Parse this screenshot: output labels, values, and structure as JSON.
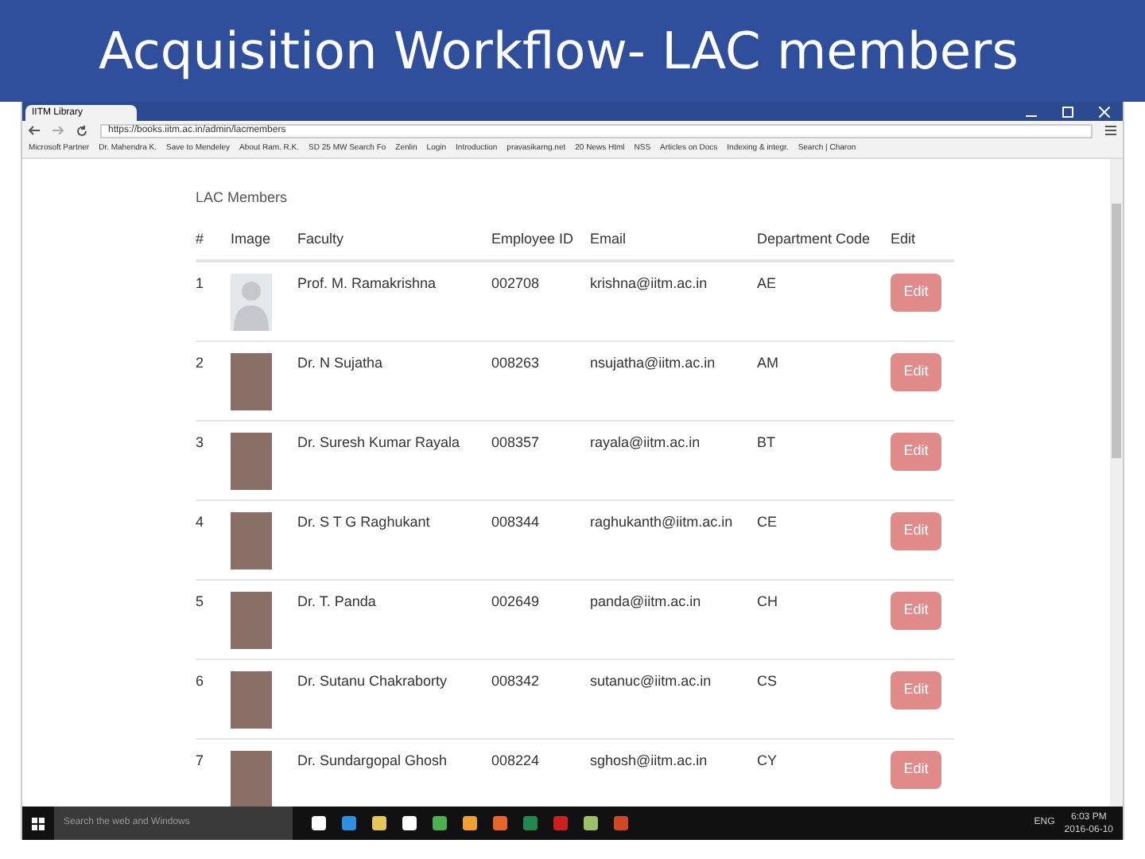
{
  "slide": {
    "title": "Acquisition Workflow- LAC members"
  },
  "browser": {
    "tab": {
      "title": "IITM Library",
      "selected": true
    },
    "url": "https://books.iitm.ac.in/admin/lacmembers",
    "bookmarks": [
      "Microsoft Partner",
      "Dr. Mahendra K.",
      "Save to Mendeley",
      "About Ram. R.K.",
      "SD 25 MW Search Fo",
      "Zenlin",
      "Login",
      "Introduction",
      "pravasikarng.net",
      "20 News Html",
      "NSS",
      "Articles on Docs",
      "Indexing & integr.",
      "Search | Charon"
    ]
  },
  "page": {
    "heading": "LAC Members",
    "table": {
      "columns": [
        "#",
        "Image",
        "Faculty",
        "Employee ID",
        "Email",
        "Department Code",
        "Edit"
      ],
      "rows": [
        {
          "number": "1",
          "kind": "placeholder",
          "faculty": "Prof. M. Ramakrishna",
          "employee_id": "002708",
          "email": "krishna@iitm.ac.in",
          "department": "AE",
          "action": "Edit"
        },
        {
          "number": "2",
          "kind": "photo",
          "faculty": "Dr. N Sujatha",
          "employee_id": "008263",
          "email": "nsujatha@iitm.ac.in",
          "department": "AM",
          "action": "Edit"
        },
        {
          "number": "3",
          "kind": "photo",
          "faculty": "Dr. Suresh Kumar Rayala",
          "employee_id": "008357",
          "email": "rayala@iitm.ac.in",
          "department": "BT",
          "action": "Edit"
        },
        {
          "number": "4",
          "kind": "photo",
          "faculty": "Dr. S T G Raghukant",
          "employee_id": "008344",
          "email": "raghukanth@iitm.ac.in",
          "department": "CE",
          "action": "Edit"
        },
        {
          "number": "5",
          "kind": "photo",
          "faculty": "Dr. T. Panda",
          "employee_id": "002649",
          "email": "panda@iitm.ac.in",
          "department": "CH",
          "action": "Edit"
        },
        {
          "number": "6",
          "kind": "photo",
          "faculty": "Dr. Sutanu Chakraborty",
          "employee_id": "008342",
          "email": "sutanuc@iitm.ac.in",
          "department": "CS",
          "action": "Edit"
        },
        {
          "number": "7",
          "kind": "photo",
          "faculty": "Dr. Sundargopal Ghosh",
          "employee_id": "008224",
          "email": "sghosh@iitm.ac.in",
          "department": "CY",
          "action": "Edit"
        }
      ]
    }
  },
  "taskbar": {
    "search_placeholder": "Search the web and Windows",
    "language": "ENG",
    "time": "6:03 PM",
    "date": "2016-06-10"
  }
}
